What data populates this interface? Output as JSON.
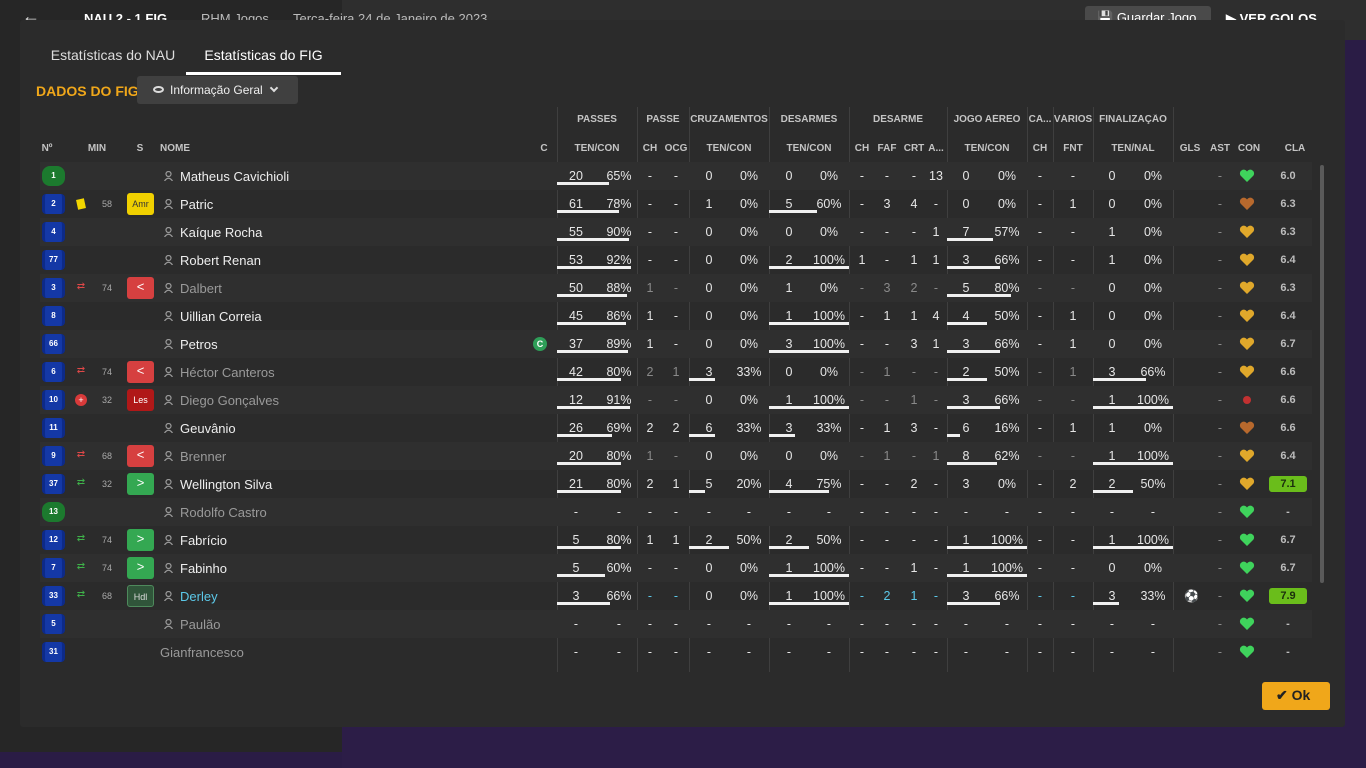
{
  "top": {
    "score": "NAU  2 - 1  FIG",
    "venue": "RHM Jogos",
    "date": "Terça-feira 24 de Janeiro de 2023",
    "save_label": "Guardar Jogo",
    "goals_label": "VER GOLOS"
  },
  "tabs": [
    {
      "label": "Estatísticas do NAU"
    },
    {
      "label": "Estatísticas do FIG"
    }
  ],
  "active_tab": 1,
  "section_title": "DADOS DO FIG",
  "view_dropdown": {
    "label": "Informação Geral",
    "icon": "eye-icon"
  },
  "group_headers": [
    "PASSES",
    "PASSE",
    "CRUZAMENTOS",
    "DESARMES",
    "DESARME",
    "JOGO AÉREO",
    "CA...",
    "VÁRIOS",
    "FINALIZAÇÃO"
  ],
  "columns": [
    "Nº",
    "MIN",
    "S",
    "NOME",
    "C",
    "TEN/CON",
    "CH",
    "OCG",
    "TEN/CON",
    "TEN/CON",
    "CH",
    "FAF",
    "CRT",
    "A...",
    "TEN/CON",
    "CH",
    "FNT",
    "TEN/NAL",
    "GLS",
    "AST",
    "CON",
    "CLA"
  ],
  "players": [
    {
      "num": "1",
      "shirt": "green",
      "event": "",
      "min": "",
      "status": "",
      "status_label": "",
      "name": "Matheus Cavichioli",
      "style": "",
      "captain": false,
      "pass": [
        "20",
        "65%"
      ],
      "ch": "-",
      "ocg": "-",
      "cross": [
        "0",
        "0%"
      ],
      "tackle": [
        "0",
        "0%"
      ],
      "d_ch": "-",
      "faf": "-",
      "crt": "-",
      "a": "13",
      "air": [
        "0",
        "0%"
      ],
      "ca": "-",
      "fnt": "-",
      "shot": [
        "0",
        "0%"
      ],
      "gls": "",
      "ast": "-",
      "con": "green",
      "rating": "6.0",
      "rating_hi": false,
      "dim": false
    },
    {
      "num": "2",
      "shirt": "blue",
      "event": "yellow",
      "min": "58",
      "status": "amr",
      "status_label": "Amr",
      "name": "Patric",
      "style": "",
      "captain": false,
      "pass": [
        "61",
        "78%"
      ],
      "ch": "-",
      "ocg": "-",
      "cross": [
        "1",
        "0%"
      ],
      "tackle": [
        "5",
        "60%"
      ],
      "d_ch": "-",
      "faf": "3",
      "crt": "4",
      "a": "-",
      "air": [
        "0",
        "0%"
      ],
      "ca": "-",
      "fnt": "1",
      "shot": [
        "0",
        "0%"
      ],
      "gls": "",
      "ast": "-",
      "con": "brown",
      "rating": "6.3",
      "rating_hi": false,
      "dim": false
    },
    {
      "num": "4",
      "shirt": "blue",
      "event": "",
      "min": "",
      "status": "",
      "status_label": "",
      "name": "Kaíque Rocha",
      "style": "",
      "captain": false,
      "pass": [
        "55",
        "90%"
      ],
      "ch": "-",
      "ocg": "-",
      "cross": [
        "0",
        "0%"
      ],
      "tackle": [
        "0",
        "0%"
      ],
      "d_ch": "-",
      "faf": "-",
      "crt": "-",
      "a": "1",
      "air": [
        "7",
        "57%"
      ],
      "ca": "-",
      "fnt": "-",
      "shot": [
        "1",
        "0%"
      ],
      "gls": "",
      "ast": "-",
      "con": "gold",
      "rating": "6.3",
      "rating_hi": false,
      "dim": false
    },
    {
      "num": "77",
      "shirt": "blue",
      "event": "",
      "min": "",
      "status": "",
      "status_label": "",
      "name": "Robert Renan",
      "style": "",
      "captain": false,
      "pass": [
        "53",
        "92%"
      ],
      "ch": "-",
      "ocg": "-",
      "cross": [
        "0",
        "0%"
      ],
      "tackle": [
        "2",
        "100%"
      ],
      "d_ch": "1",
      "faf": "-",
      "crt": "1",
      "a": "1",
      "air": [
        "3",
        "66%"
      ],
      "ca": "-",
      "fnt": "-",
      "shot": [
        "1",
        "0%"
      ],
      "gls": "",
      "ast": "-",
      "con": "gold",
      "rating": "6.4",
      "rating_hi": false,
      "dim": false
    },
    {
      "num": "3",
      "shirt": "blue",
      "event": "sub-out",
      "min": "74",
      "status": "out",
      "status_label": "<",
      "name": "Dalbert",
      "style": "dim",
      "captain": false,
      "pass": [
        "50",
        "88%"
      ],
      "ch": "1",
      "ocg": "-",
      "cross": [
        "0",
        "0%"
      ],
      "tackle": [
        "1",
        "0%"
      ],
      "d_ch": "-",
      "faf": "3",
      "crt": "2",
      "a": "-",
      "air": [
        "5",
        "80%"
      ],
      "ca": "-",
      "fnt": "-",
      "shot": [
        "0",
        "0%"
      ],
      "gls": "",
      "ast": "-",
      "con": "gold",
      "rating": "6.3",
      "rating_hi": false,
      "dim": true
    },
    {
      "num": "8",
      "shirt": "blue",
      "event": "",
      "min": "",
      "status": "",
      "status_label": "",
      "name": "Uillian Correia",
      "style": "",
      "captain": false,
      "pass": [
        "45",
        "86%"
      ],
      "ch": "1",
      "ocg": "-",
      "cross": [
        "0",
        "0%"
      ],
      "tackle": [
        "1",
        "100%"
      ],
      "d_ch": "-",
      "faf": "1",
      "crt": "1",
      "a": "4",
      "air": [
        "4",
        "50%"
      ],
      "ca": "-",
      "fnt": "1",
      "shot": [
        "0",
        "0%"
      ],
      "gls": "",
      "ast": "-",
      "con": "gold",
      "rating": "6.4",
      "rating_hi": false,
      "dim": false
    },
    {
      "num": "66",
      "shirt": "blue",
      "event": "",
      "min": "",
      "status": "",
      "status_label": "",
      "name": "Petros",
      "style": "",
      "captain": true,
      "pass": [
        "37",
        "89%"
      ],
      "ch": "1",
      "ocg": "-",
      "cross": [
        "0",
        "0%"
      ],
      "tackle": [
        "3",
        "100%"
      ],
      "d_ch": "-",
      "faf": "-",
      "crt": "3",
      "a": "1",
      "air": [
        "3",
        "66%"
      ],
      "ca": "-",
      "fnt": "1",
      "shot": [
        "0",
        "0%"
      ],
      "gls": "",
      "ast": "-",
      "con": "gold",
      "rating": "6.7",
      "rating_hi": false,
      "dim": false
    },
    {
      "num": "6",
      "shirt": "blue",
      "event": "sub-out",
      "min": "74",
      "status": "out",
      "status_label": "<",
      "name": "Héctor Canteros",
      "style": "dim",
      "captain": false,
      "pass": [
        "42",
        "80%"
      ],
      "ch": "2",
      "ocg": "1",
      "cross": [
        "3",
        "33%"
      ],
      "tackle": [
        "0",
        "0%"
      ],
      "d_ch": "-",
      "faf": "1",
      "crt": "-",
      "a": "-",
      "air": [
        "2",
        "50%"
      ],
      "ca": "-",
      "fnt": "1",
      "shot": [
        "3",
        "66%"
      ],
      "gls": "",
      "ast": "-",
      "con": "gold",
      "rating": "6.6",
      "rating_hi": false,
      "dim": true
    },
    {
      "num": "10",
      "shirt": "blue",
      "event": "injury",
      "min": "32",
      "status": "les",
      "status_label": "Les",
      "name": "Diego Gonçalves",
      "style": "dim",
      "captain": false,
      "pass": [
        "12",
        "91%"
      ],
      "ch": "-",
      "ocg": "-",
      "cross": [
        "0",
        "0%"
      ],
      "tackle": [
        "1",
        "100%"
      ],
      "d_ch": "-",
      "faf": "-",
      "crt": "1",
      "a": "-",
      "air": [
        "3",
        "66%"
      ],
      "ca": "-",
      "fnt": "-",
      "shot": [
        "1",
        "100%"
      ],
      "gls": "",
      "ast": "-",
      "con": "red",
      "rating": "6.6",
      "rating_hi": false,
      "dim": true
    },
    {
      "num": "11",
      "shirt": "blue",
      "event": "",
      "min": "",
      "status": "",
      "status_label": "",
      "name": "Geuvânio",
      "style": "",
      "captain": false,
      "pass": [
        "26",
        "69%"
      ],
      "ch": "2",
      "ocg": "2",
      "cross": [
        "6",
        "33%"
      ],
      "tackle": [
        "3",
        "33%"
      ],
      "d_ch": "-",
      "faf": "1",
      "crt": "3",
      "a": "-",
      "air": [
        "6",
        "16%"
      ],
      "ca": "-",
      "fnt": "1",
      "shot": [
        "1",
        "0%"
      ],
      "gls": "",
      "ast": "-",
      "con": "brown",
      "rating": "6.6",
      "rating_hi": false,
      "dim": false
    },
    {
      "num": "9",
      "shirt": "blue",
      "event": "sub-out",
      "min": "68",
      "status": "out",
      "status_label": "<",
      "name": "Brenner",
      "style": "dim",
      "captain": false,
      "pass": [
        "20",
        "80%"
      ],
      "ch": "1",
      "ocg": "-",
      "cross": [
        "0",
        "0%"
      ],
      "tackle": [
        "0",
        "0%"
      ],
      "d_ch": "-",
      "faf": "1",
      "crt": "-",
      "a": "1",
      "air": [
        "8",
        "62%"
      ],
      "ca": "-",
      "fnt": "-",
      "shot": [
        "1",
        "100%"
      ],
      "gls": "",
      "ast": "-",
      "con": "gold",
      "rating": "6.4",
      "rating_hi": false,
      "dim": true
    },
    {
      "num": "37",
      "shirt": "blue",
      "event": "sub-in",
      "min": "32",
      "status": "in",
      "status_label": ">",
      "name": "Wellington Silva",
      "style": "",
      "captain": false,
      "pass": [
        "21",
        "80%"
      ],
      "ch": "2",
      "ocg": "1",
      "cross": [
        "5",
        "20%"
      ],
      "tackle": [
        "4",
        "75%"
      ],
      "d_ch": "-",
      "faf": "-",
      "crt": "2",
      "a": "-",
      "air": [
        "3",
        "0%"
      ],
      "ca": "-",
      "fnt": "2",
      "shot": [
        "2",
        "50%"
      ],
      "gls": "",
      "ast": "-",
      "con": "gold",
      "rating": "7.1",
      "rating_hi": true,
      "dim": false
    },
    {
      "num": "13",
      "shirt": "green",
      "event": "",
      "min": "",
      "status": "",
      "status_label": "",
      "name": "Rodolfo Castro",
      "style": "dim",
      "captain": false,
      "pass": [
        "-",
        "-"
      ],
      "ch": "-",
      "ocg": "-",
      "cross": [
        "-",
        "-"
      ],
      "tackle": [
        "-",
        "-"
      ],
      "d_ch": "-",
      "faf": "-",
      "crt": "-",
      "a": "-",
      "air": [
        "-",
        "-"
      ],
      "ca": "-",
      "fnt": "-",
      "shot": [
        "-",
        "-"
      ],
      "gls": "",
      "ast": "-",
      "con": "green",
      "rating": "-",
      "rating_hi": false,
      "dim": false
    },
    {
      "num": "12",
      "shirt": "blue",
      "event": "sub-in",
      "min": "74",
      "status": "in",
      "status_label": ">",
      "name": "Fabrício",
      "style": "",
      "captain": false,
      "pass": [
        "5",
        "80%"
      ],
      "ch": "1",
      "ocg": "1",
      "cross": [
        "2",
        "50%"
      ],
      "tackle": [
        "2",
        "50%"
      ],
      "d_ch": "-",
      "faf": "-",
      "crt": "-",
      "a": "-",
      "air": [
        "1",
        "100%"
      ],
      "ca": "-",
      "fnt": "-",
      "shot": [
        "1",
        "100%"
      ],
      "gls": "",
      "ast": "-",
      "con": "green",
      "rating": "6.7",
      "rating_hi": false,
      "dim": false
    },
    {
      "num": "7",
      "shirt": "blue",
      "event": "sub-in",
      "min": "74",
      "status": "in",
      "status_label": ">",
      "name": "Fabinho",
      "style": "",
      "captain": false,
      "pass": [
        "5",
        "60%"
      ],
      "ch": "-",
      "ocg": "-",
      "cross": [
        "0",
        "0%"
      ],
      "tackle": [
        "1",
        "100%"
      ],
      "d_ch": "-",
      "faf": "-",
      "crt": "1",
      "a": "-",
      "air": [
        "1",
        "100%"
      ],
      "ca": "-",
      "fnt": "-",
      "shot": [
        "0",
        "0%"
      ],
      "gls": "",
      "ast": "-",
      "con": "green",
      "rating": "6.7",
      "rating_hi": false,
      "dim": false
    },
    {
      "num": "33",
      "shirt": "blue",
      "event": "sub-in",
      "min": "68",
      "status": "hdl",
      "status_label": "Hdl",
      "name": "Derley",
      "style": "cyan",
      "captain": false,
      "pass": [
        "3",
        "66%"
      ],
      "ch": "-",
      "ocg": "-",
      "cross": [
        "0",
        "0%"
      ],
      "tackle": [
        "1",
        "100%"
      ],
      "d_ch": "-",
      "faf": "2",
      "crt": "1",
      "a": "-",
      "air": [
        "3",
        "66%"
      ],
      "ca": "-",
      "fnt": "-",
      "shot": [
        "3",
        "33%"
      ],
      "gls": "⚽",
      "ast": "-",
      "con": "green",
      "rating": "7.9",
      "rating_hi": true,
      "dim": false,
      "cyan": true
    },
    {
      "num": "5",
      "shirt": "blue",
      "event": "",
      "min": "",
      "status": "",
      "status_label": "",
      "name": "Paulão",
      "style": "dim",
      "captain": false,
      "pass": [
        "-",
        "-"
      ],
      "ch": "-",
      "ocg": "-",
      "cross": [
        "-",
        "-"
      ],
      "tackle": [
        "-",
        "-"
      ],
      "d_ch": "-",
      "faf": "-",
      "crt": "-",
      "a": "-",
      "air": [
        "-",
        "-"
      ],
      "ca": "-",
      "fnt": "-",
      "shot": [
        "-",
        "-"
      ],
      "gls": "",
      "ast": "-",
      "con": "green",
      "rating": "-",
      "rating_hi": false,
      "dim": false
    },
    {
      "num": "31",
      "shirt": "blue",
      "event": "",
      "min": "",
      "status": "",
      "status_label": "",
      "name": "Gianfrancesco",
      "style": "dim",
      "captain": false,
      "nopic": true,
      "pass": [
        "-",
        "-"
      ],
      "ch": "-",
      "ocg": "-",
      "cross": [
        "-",
        "-"
      ],
      "tackle": [
        "-",
        "-"
      ],
      "d_ch": "-",
      "faf": "-",
      "crt": "-",
      "a": "-",
      "air": [
        "-",
        "-"
      ],
      "ca": "-",
      "fnt": "-",
      "shot": [
        "-",
        "-"
      ],
      "gls": "",
      "ast": "-",
      "con": "green",
      "rating": "-",
      "rating_hi": false,
      "dim": false
    }
  ],
  "captain_label": "C",
  "ok_label": "Ok",
  "colors": {
    "accent": "#f0a71a",
    "rating_high": "#6abd1b",
    "sub_in": "#34a852",
    "sub_out": "#d64040"
  }
}
